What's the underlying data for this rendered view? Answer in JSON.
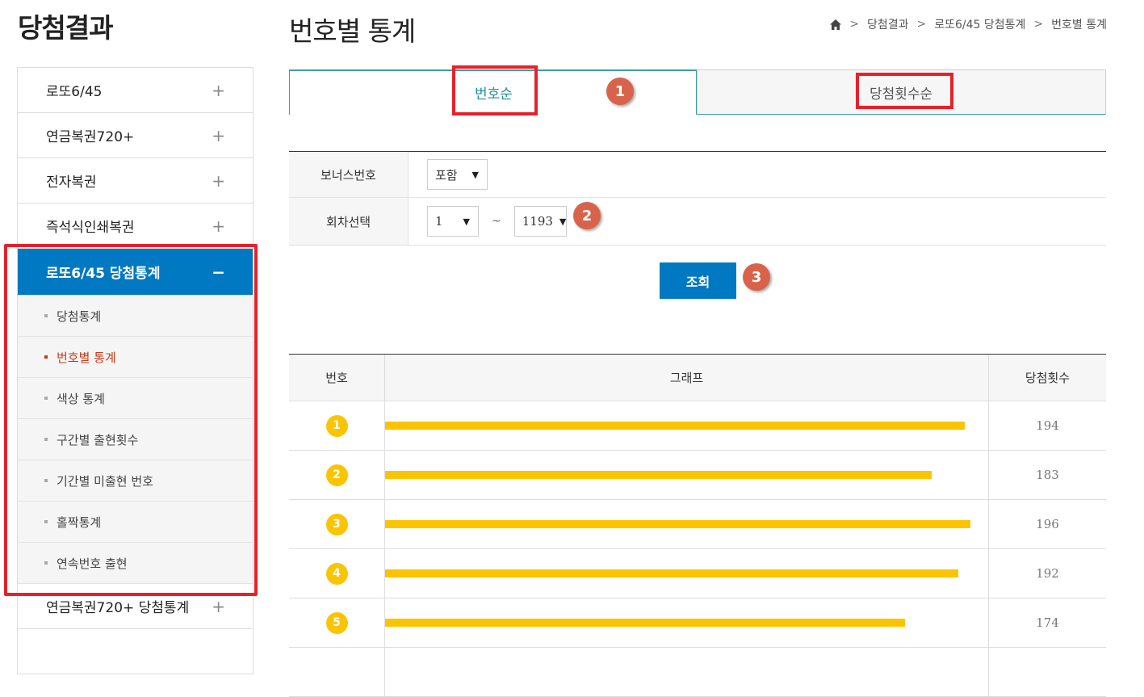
{
  "sidebar": {
    "title": "당첨결과",
    "items": [
      {
        "label": "로또6/45",
        "toggle": "+"
      },
      {
        "label": "연금복권720+",
        "toggle": "+"
      },
      {
        "label": "전자복권",
        "toggle": "+"
      },
      {
        "label": "즉석식인쇄복권",
        "toggle": "+"
      },
      {
        "label": "로또6/45 당첨통계",
        "toggle": "−"
      }
    ],
    "sub_items": [
      "당첨통계",
      "번호별 통계",
      "색상 통계",
      "구간별 출현횟수",
      "기간별 미출현 번호",
      "홀짝통계",
      "연속번호 출현"
    ],
    "after_items": [
      {
        "label": "연금복권720+ 당첨통계",
        "toggle": "+"
      }
    ]
  },
  "header": {
    "title": "번호별 통계",
    "breadcrumb": [
      "당첨결과",
      "로또6/45 당첨통계",
      "번호별 통계"
    ],
    "separator": ">"
  },
  "tabs": [
    {
      "label": "번호순",
      "active": true
    },
    {
      "label": "당첨횟수순",
      "active": false
    }
  ],
  "badges": [
    "1",
    "2",
    "3"
  ],
  "filter": {
    "bonus_label": "보너스번호",
    "bonus_value": "포함",
    "round_label": "회차선택",
    "round_from": "1",
    "round_to": "1193",
    "tilde": "~",
    "arrow": "▼",
    "search_button": "조회"
  },
  "table": {
    "headers": [
      "번호",
      "그래프",
      "당첨횟수"
    ],
    "rows": [
      {
        "number": "1",
        "count": 194
      },
      {
        "number": "2",
        "count": 183
      },
      {
        "number": "3",
        "count": 196
      },
      {
        "number": "4",
        "count": 192
      },
      {
        "number": "5",
        "count": 174
      }
    ]
  },
  "colors": {
    "accent_blue": "#0079c2",
    "ball_yellow": "#fbc400",
    "highlight_red": "#e8202a",
    "badge_orange": "#d8634a",
    "tab_teal": "#1c8f95"
  }
}
